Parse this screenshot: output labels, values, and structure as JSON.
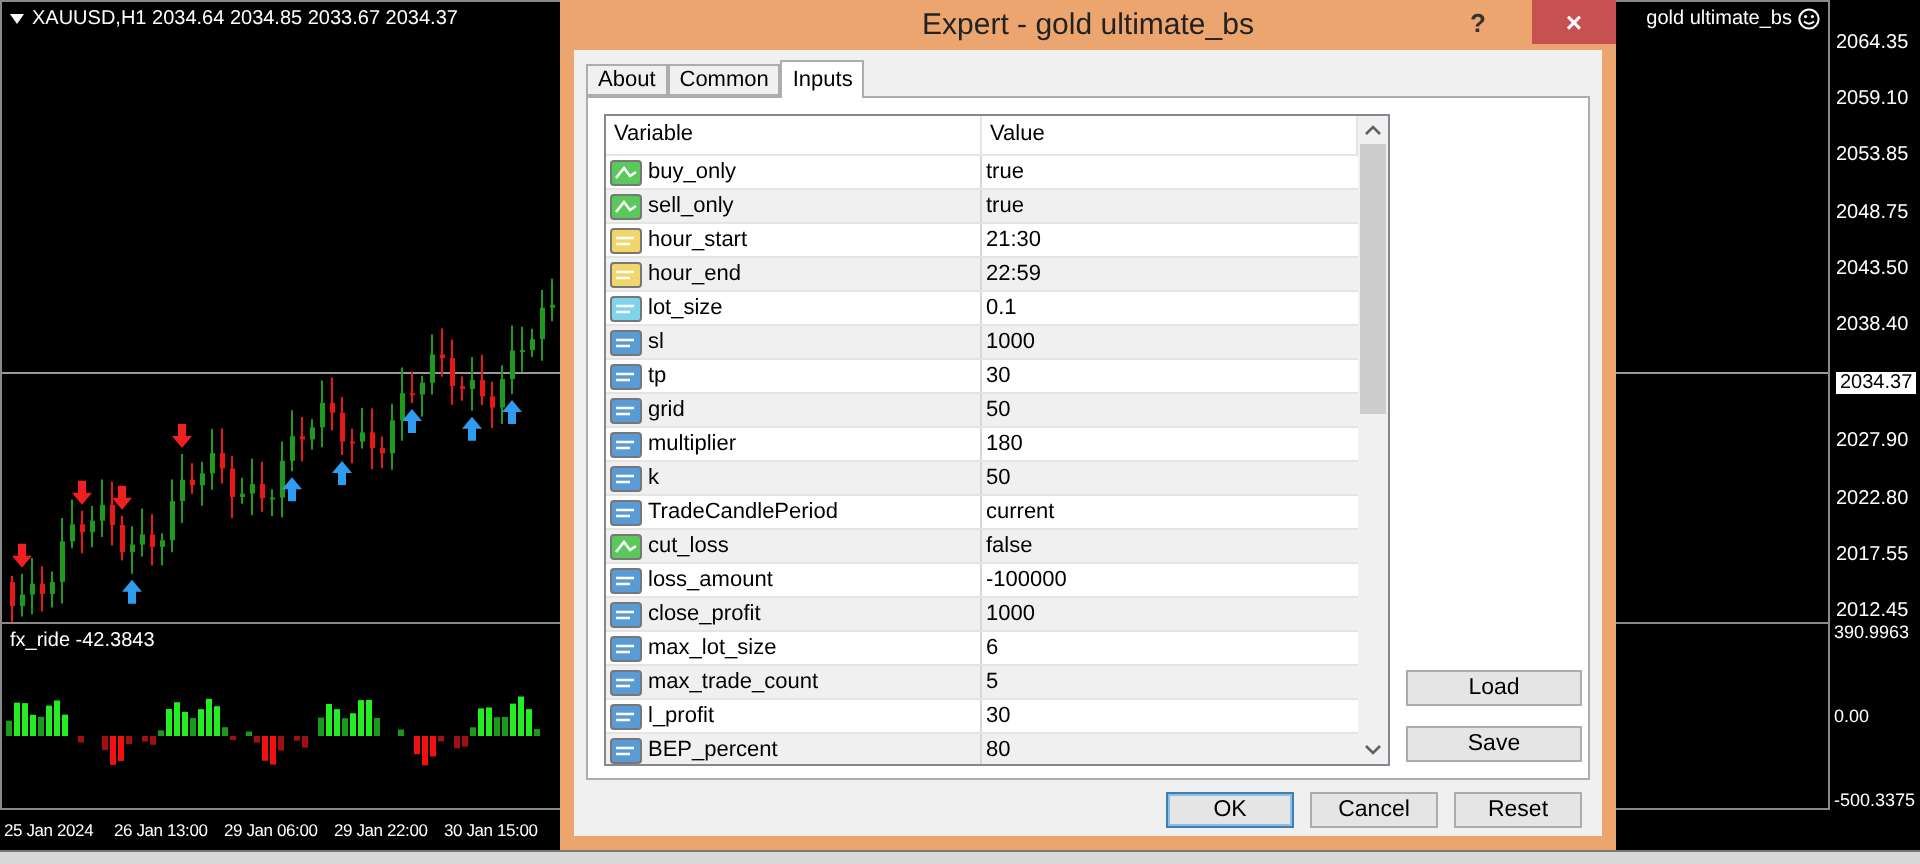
{
  "chart": {
    "symbol_info": "XAUUSD,H1  2034.64 2034.85 2033.67 2034.37",
    "expert_label": "gold ultimate_bs",
    "price_ticks": [
      {
        "kind": "tick",
        "text": "2064.35"
      },
      {
        "kind": "tick",
        "text": "2059.10"
      },
      {
        "kind": "tick",
        "text": "2053.85"
      },
      {
        "kind": "tick",
        "text": "2048.75"
      },
      {
        "kind": "tick",
        "text": "2043.50"
      },
      {
        "kind": "tick",
        "text": "2038.40"
      },
      {
        "kind": "current",
        "text": "2034.37"
      },
      {
        "kind": "tick",
        "text": "2027.90"
      },
      {
        "kind": "tick",
        "text": "2022.80"
      },
      {
        "kind": "tick",
        "text": "2017.55"
      },
      {
        "kind": "tick",
        "text": "2012.45"
      }
    ],
    "indicator": {
      "label": "fx_ride -42.3843",
      "ticks": [
        "390.9963",
        "0.00",
        "-500.3375"
      ]
    },
    "time_ticks": [
      "25 Jan 2024",
      "26 Jan 13:00",
      "29 Jan 06:00",
      "29 Jan 22:00",
      "30 Jan 15:00"
    ]
  },
  "dialog": {
    "title": "Expert - gold ultimate_bs",
    "help": "?",
    "close": "×",
    "tabs": [
      {
        "label": "About",
        "selected": false
      },
      {
        "label": "Common",
        "selected": false
      },
      {
        "label": "Inputs",
        "selected": true
      }
    ],
    "columns": [
      "Variable",
      "Value"
    ],
    "rows": [
      {
        "kind": "bool",
        "name": "buy_only",
        "value": "true"
      },
      {
        "kind": "bool",
        "name": "sell_only",
        "value": "true"
      },
      {
        "kind": "string",
        "name": "hour_start",
        "value": "21:30"
      },
      {
        "kind": "string",
        "name": "hour_end",
        "value": "22:59"
      },
      {
        "kind": "double",
        "name": "lot_size",
        "value": "0.1"
      },
      {
        "kind": "int",
        "name": "sl",
        "value": "1000"
      },
      {
        "kind": "int",
        "name": "tp",
        "value": "30"
      },
      {
        "kind": "int",
        "name": "grid",
        "value": "50"
      },
      {
        "kind": "int",
        "name": "multiplier",
        "value": "180"
      },
      {
        "kind": "int",
        "name": "k",
        "value": "50"
      },
      {
        "kind": "int",
        "name": "TradeCandlePeriod",
        "value": "current"
      },
      {
        "kind": "bool",
        "name": "cut_loss",
        "value": "false"
      },
      {
        "kind": "int",
        "name": "loss_amount",
        "value": "-100000"
      },
      {
        "kind": "int",
        "name": "close_profit",
        "value": "1000"
      },
      {
        "kind": "int",
        "name": "max_lot_size",
        "value": "6"
      },
      {
        "kind": "int",
        "name": "max_trade_count",
        "value": "5"
      },
      {
        "kind": "int",
        "name": "l_profit",
        "value": "30"
      },
      {
        "kind": "int",
        "name": "BEP_percent",
        "value": "80"
      }
    ],
    "side_buttons": [
      "Load",
      "Save"
    ],
    "buttons": [
      {
        "label": "OK",
        "default": true
      },
      {
        "label": "Cancel",
        "default": false
      },
      {
        "label": "Reset",
        "default": false
      }
    ]
  }
}
